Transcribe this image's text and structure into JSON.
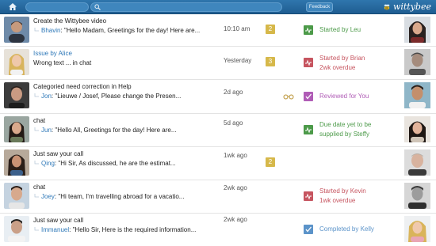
{
  "topbar": {
    "feedback_label": "Feedback",
    "logo_text": "wittybee",
    "icons": [
      "home-icon",
      "search-icon",
      "bee-logo"
    ],
    "accent": "#2f76ad"
  },
  "status_colors": {
    "started": "#c6545f",
    "reviewed": "#b05cb6",
    "done": "#4c9a49",
    "completed": "#5b93c9",
    "badge": "#d6b84a"
  },
  "rows": [
    {
      "subject": "Create the Wittybee video",
      "sender": "Bhavin",
      "message": "\"Hello Madam, Greetings for the day! Here are...",
      "time": "10:10 am",
      "badge": "2",
      "status_line1": "Started by Leu",
      "status_line2": ""
    },
    {
      "subject": "Issue by Alice",
      "sender": "",
      "message": "Wrong text ... in chat",
      "time": "Yesterday",
      "badge": "3",
      "status_line1": "Started by Brian",
      "status_line2": "2wk overdue"
    },
    {
      "subject": "Categoried need correction in Help",
      "sender": "Jon",
      "message": "\"Lieuwe / Josef, Please change the Presen...",
      "time": "2d ago",
      "badge": "",
      "status_line1": "Reviewed for You",
      "status_line2": ""
    },
    {
      "subject": "chat",
      "sender": "Jun",
      "message": "\"Hello All, Greetings for the day! Here are...",
      "time": "5d ago",
      "badge": "",
      "status_line1": "Due date yet to be",
      "status_line2": "supplied by Steffy"
    },
    {
      "subject": "Just saw your call",
      "sender": "Qing",
      "message": "\"Hi Sir, As discussed, he are the estimat...",
      "time": "1wk ago",
      "badge": "2",
      "status_line1": "",
      "status_line2": ""
    },
    {
      "subject": "chat",
      "sender": "Joey",
      "message": "\"Hi team, I'm travelling abroad for a vacatio...",
      "time": "2wk ago",
      "badge": "",
      "status_line1": "Started by Kevin",
      "status_line2": "1wk overdue"
    },
    {
      "subject": "Just saw your call",
      "sender": "Immanuel",
      "message": "\"Hello Sir, Here is the required information...",
      "time": "2wk ago",
      "badge": "",
      "status_line1": "Completed by Kelly",
      "status_line2": ""
    }
  ]
}
